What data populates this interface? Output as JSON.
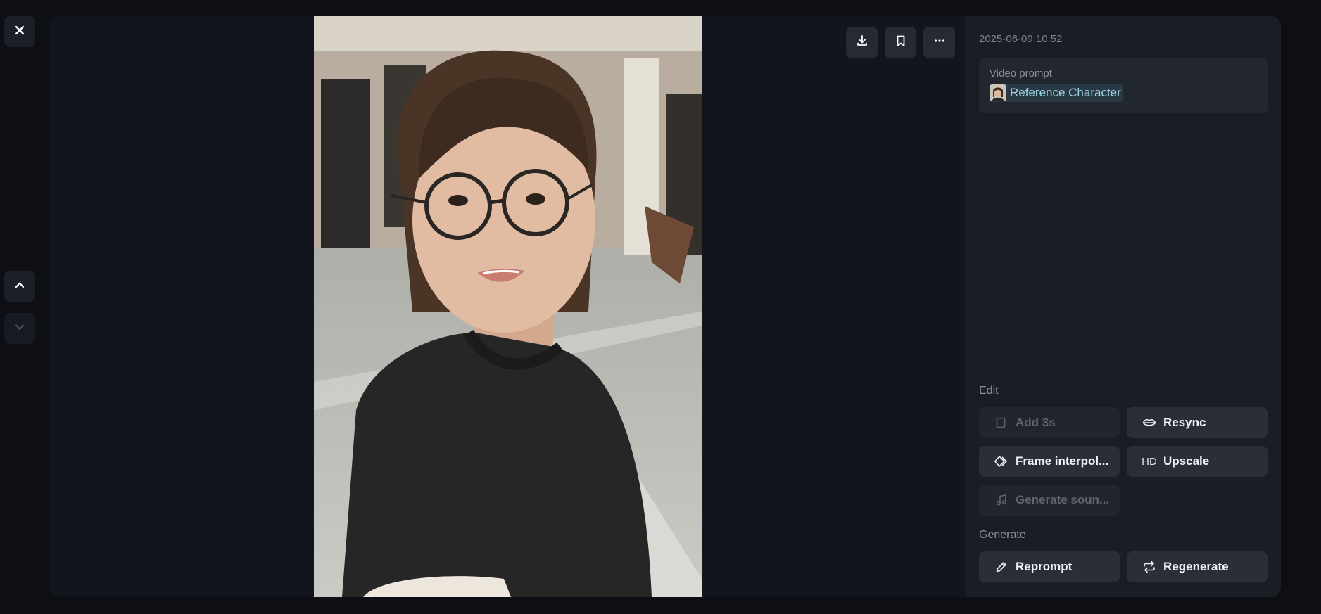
{
  "timestamp": "2025-06-09 10:52",
  "prompt": {
    "label": "Video prompt",
    "reference": "Reference Character"
  },
  "edit": {
    "label": "Edit",
    "add": "Add 3s",
    "resync": "Resync",
    "frame": "Frame interpol...",
    "upscale": "Upscale",
    "upscale_glyph": "HD",
    "sound": "Generate soun..."
  },
  "generate": {
    "label": "Generate",
    "reprompt": "Reprompt",
    "regenerate": "Regenerate"
  },
  "icons": {
    "close": "close-icon",
    "up": "chevron-up-icon",
    "down": "chevron-down-icon",
    "download": "download-icon",
    "bookmark": "bookmark-icon",
    "more": "more-icon"
  },
  "colors": {
    "background": "#0d0f14",
    "panel": "#1a1d24",
    "button": "#2a2e37",
    "reference_chip": "#2a3a44",
    "reference_text": "#9fd2e6"
  }
}
